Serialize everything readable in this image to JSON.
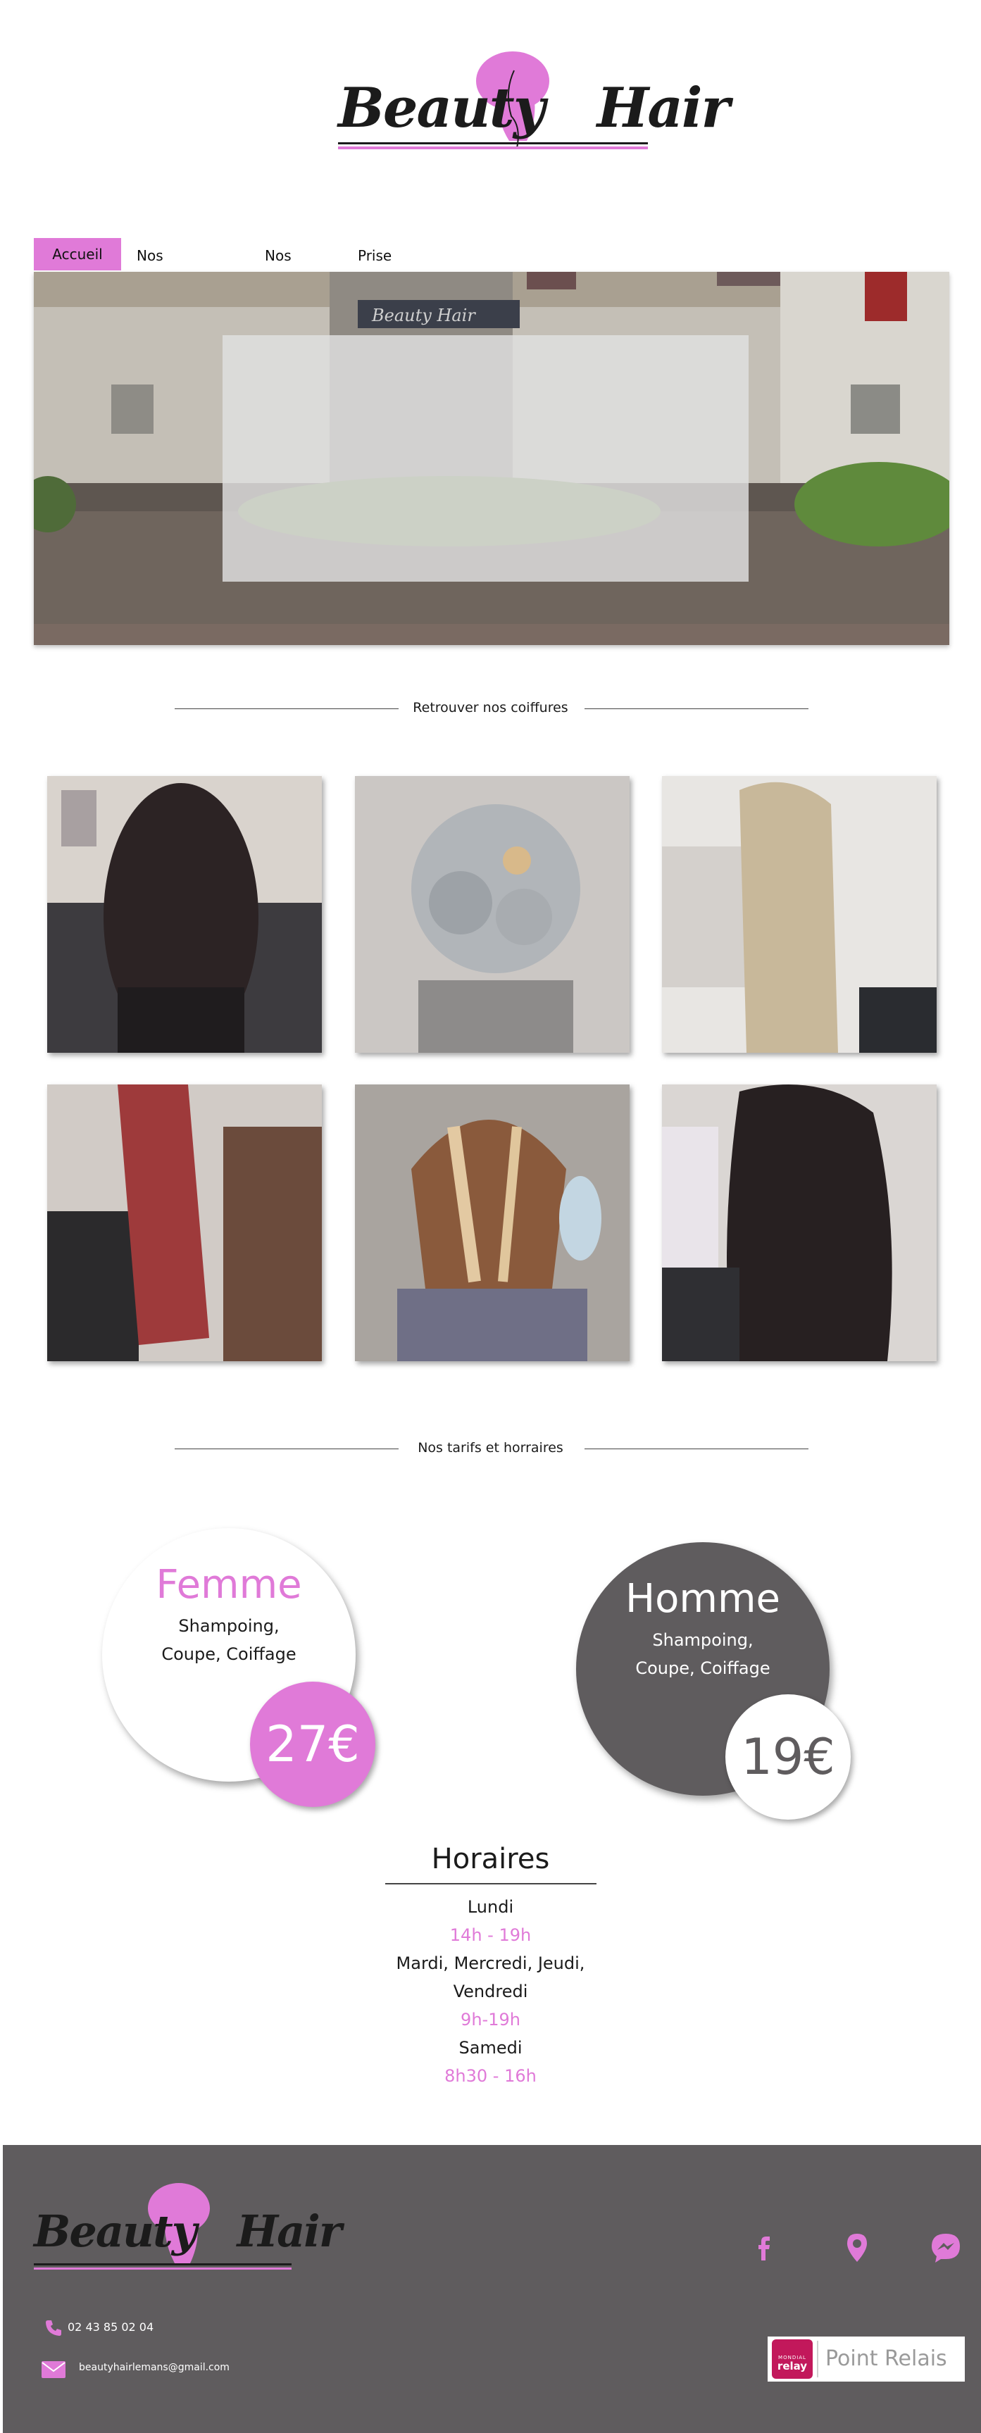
{
  "brand": {
    "name_part1": "Beauty",
    "name_part2": "Hair",
    "pink": "#e07ad8",
    "dark": "#5f5c5e"
  },
  "nav": {
    "items": [
      {
        "label": "Accueil",
        "active": true
      },
      {
        "label": "Nos Coiffure",
        "active": false
      },
      {
        "label": "Nos Tarif",
        "active": false
      },
      {
        "label": "Prise de RDV",
        "active": false
      }
    ]
  },
  "hero": {
    "sign_text": "Beauty Hair"
  },
  "gallery": {
    "title": "Retrouver nos coiffures",
    "photos": [
      {
        "desc": "dark brown straight hair"
      },
      {
        "desc": "grey curly updo with hair accessory"
      },
      {
        "desc": "long straight blonde hair"
      },
      {
        "desc": "long straight red hair"
      },
      {
        "desc": "highlighted bob cut"
      },
      {
        "desc": "long dark wavy hair"
      }
    ]
  },
  "pricing": {
    "title": "Nos tarifs et horraires",
    "femme": {
      "title": "Femme",
      "line1": "Shampoing,",
      "line2": "Coupe, Coiffage",
      "price": "27€"
    },
    "homme": {
      "title": "Homme",
      "line1": "Shampoing,",
      "line2": "Coupe, Coiffage",
      "price": "19€"
    }
  },
  "hours": {
    "title": "Horaires",
    "entries": [
      {
        "days": "Lundi",
        "time": "14h - 19h"
      },
      {
        "days": "Mardi, Mercredi, Jeudi,",
        "days2": "Vendredi",
        "time": "9h-19h"
      },
      {
        "days": "Samedi",
        "time": "8h30 - 16h"
      }
    ]
  },
  "footer": {
    "phone": "02 43 85 02 04",
    "email": "beautyhairlemans@gmail.com",
    "relay_badge_line1": "MONDIAL",
    "relay_badge_line2": "relay",
    "relay_label": "Point Relais",
    "icons": [
      "facebook-icon",
      "map-pin-icon",
      "messenger-icon",
      "phone-icon",
      "mail-icon"
    ]
  }
}
